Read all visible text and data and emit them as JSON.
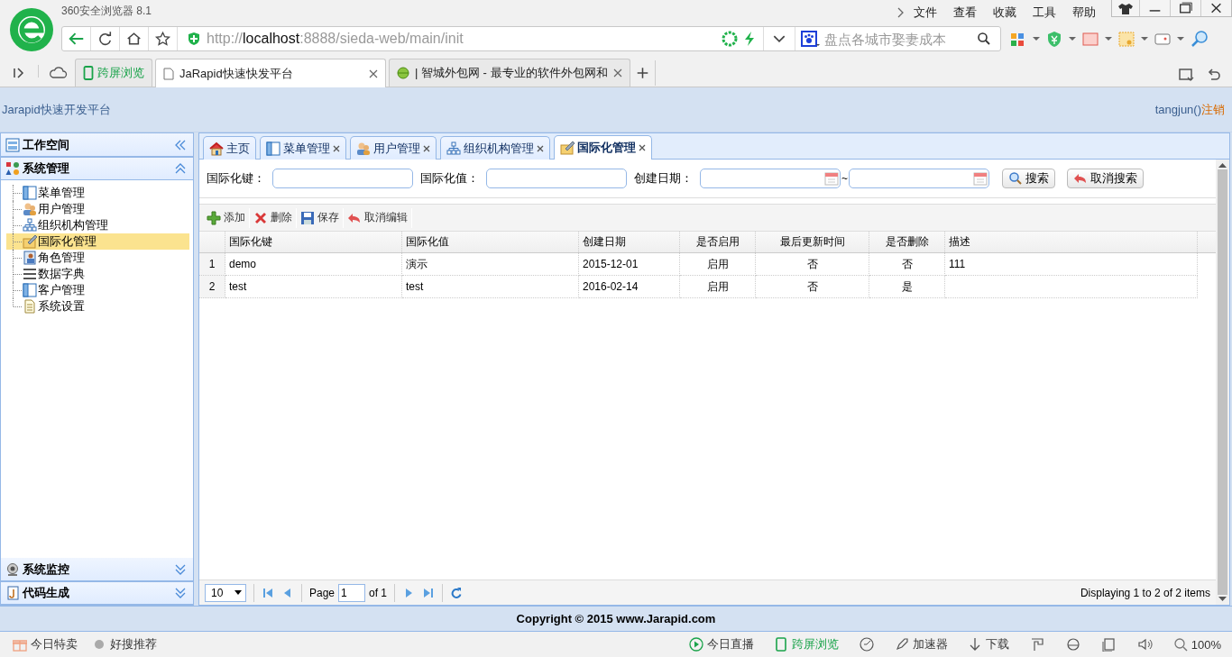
{
  "browser": {
    "title": "360安全浏览器 8.1",
    "menu": [
      "文件",
      "查看",
      "收藏",
      "工具",
      "帮助"
    ],
    "address": {
      "scheme": "http://",
      "host": "localhost",
      "path": ":8888/sieda-web/main/init"
    },
    "search": {
      "placeholder": "盘点各城市娶妻成本"
    },
    "tabs": [
      {
        "label": "跨屏浏览",
        "kind": "special",
        "selected": false
      },
      {
        "label": "JaRapid快速快发平台",
        "kind": "page",
        "selected": true
      },
      {
        "label": "| 智城外包网 - 最专业的软件外包网和",
        "kind": "page",
        "selected": false
      }
    ]
  },
  "app": {
    "title": "Jarapid快速开发平台",
    "user": "tangjun()",
    "logout": "注销"
  },
  "sidebar": {
    "panels": [
      {
        "title": "工作空间"
      },
      {
        "title": "系统管理",
        "expanded": true,
        "items": [
          {
            "label": "菜单管理",
            "selected": false
          },
          {
            "label": "用户管理",
            "selected": false
          },
          {
            "label": "组织机构管理",
            "selected": false
          },
          {
            "label": "国际化管理",
            "selected": true
          },
          {
            "label": "角色管理",
            "selected": false
          },
          {
            "label": "数据字典",
            "selected": false
          },
          {
            "label": "客户管理",
            "selected": false
          },
          {
            "label": "系统设置",
            "selected": false
          }
        ]
      },
      {
        "title": "系统监控",
        "expanded": false
      },
      {
        "title": "代码生成",
        "expanded": false
      }
    ]
  },
  "tabs": [
    {
      "label": "主页",
      "closable": false,
      "selected": false
    },
    {
      "label": "菜单管理",
      "closable": true,
      "selected": false
    },
    {
      "label": "用户管理",
      "closable": true,
      "selected": false
    },
    {
      "label": "组织机构管理",
      "closable": true,
      "selected": false
    },
    {
      "label": "国际化管理",
      "closable": true,
      "selected": true
    }
  ],
  "search_form": {
    "key_label": "国际化键：",
    "value_label": "国际化值：",
    "date_label": "创建日期：",
    "range_sep": "~",
    "buttons": [
      "搜索",
      "取消搜索"
    ]
  },
  "toolbar": [
    "添加",
    "删除",
    "保存",
    "取消编辑"
  ],
  "table": {
    "columns": [
      "国际化键",
      "国际化值",
      "创建日期",
      "是否启用",
      "最后更新时间",
      "是否删除",
      "描述"
    ],
    "rows": [
      {
        "num": "1",
        "cells": [
          "demo",
          "演示",
          "2015-12-01",
          "启用",
          "否",
          "否",
          "111"
        ]
      },
      {
        "num": "2",
        "cells": [
          "test",
          "test",
          "2016-02-14",
          "启用",
          "否",
          "是",
          ""
        ]
      }
    ]
  },
  "pager": {
    "page_size": "10",
    "page_label": "Page",
    "page": "1",
    "of": "of 1",
    "display": "Displaying 1 to 2 of 2 items"
  },
  "footer": "Copyright © 2015 www.Jarapid.com",
  "status_bar": {
    "left": [
      "今日特卖",
      "好搜推荐"
    ],
    "right": [
      "今日直播",
      "跨屏浏览",
      "加速器",
      "下载"
    ],
    "zoom": "100%"
  }
}
